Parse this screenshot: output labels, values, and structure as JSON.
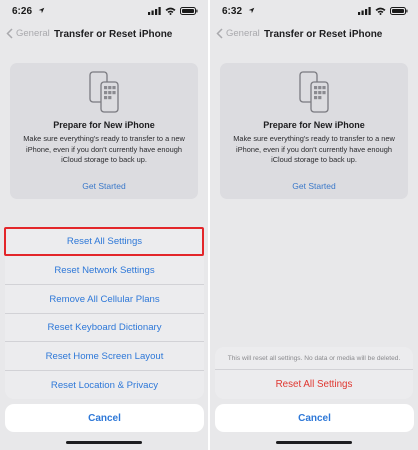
{
  "left_screen": {
    "status": {
      "time": "6:26"
    },
    "nav": {
      "back_label": "General",
      "title": "Transfer or Reset iPhone"
    },
    "card": {
      "title": "Prepare for New iPhone",
      "body": "Make sure everything's ready to transfer to a new iPhone, even if you don't currently have enough iCloud storage to back up.",
      "link": "Get Started"
    },
    "action_sheet": {
      "items": [
        {
          "label": "Reset All Settings"
        },
        {
          "label": "Reset Network Settings"
        },
        {
          "label": "Remove All Cellular Plans"
        },
        {
          "label": "Reset Keyboard Dictionary"
        },
        {
          "label": "Reset Home Screen Layout"
        },
        {
          "label": "Reset Location & Privacy"
        }
      ],
      "cancel_label": "Cancel"
    }
  },
  "right_screen": {
    "status": {
      "time": "6:32"
    },
    "nav": {
      "back_label": "General",
      "title": "Transfer or Reset iPhone"
    },
    "card": {
      "title": "Prepare for New iPhone",
      "body": "Make sure everything's ready to transfer to a new iPhone, even if you don't currently have enough iCloud storage to back up.",
      "link": "Get Started"
    },
    "confirm_sheet": {
      "message": "This will reset all settings. No data or media will be deleted.",
      "confirm_label": "Reset All Settings",
      "cancel_label": "Cancel"
    }
  },
  "colors": {
    "accent": "#2e78d8",
    "destructive": "#e0362f",
    "highlight_box": "#e3262a"
  },
  "icons": [
    "location-arrow-icon",
    "signal-icon",
    "wifi-icon",
    "battery-icon",
    "chevron-left-icon",
    "iphone-transfer-icon"
  ]
}
